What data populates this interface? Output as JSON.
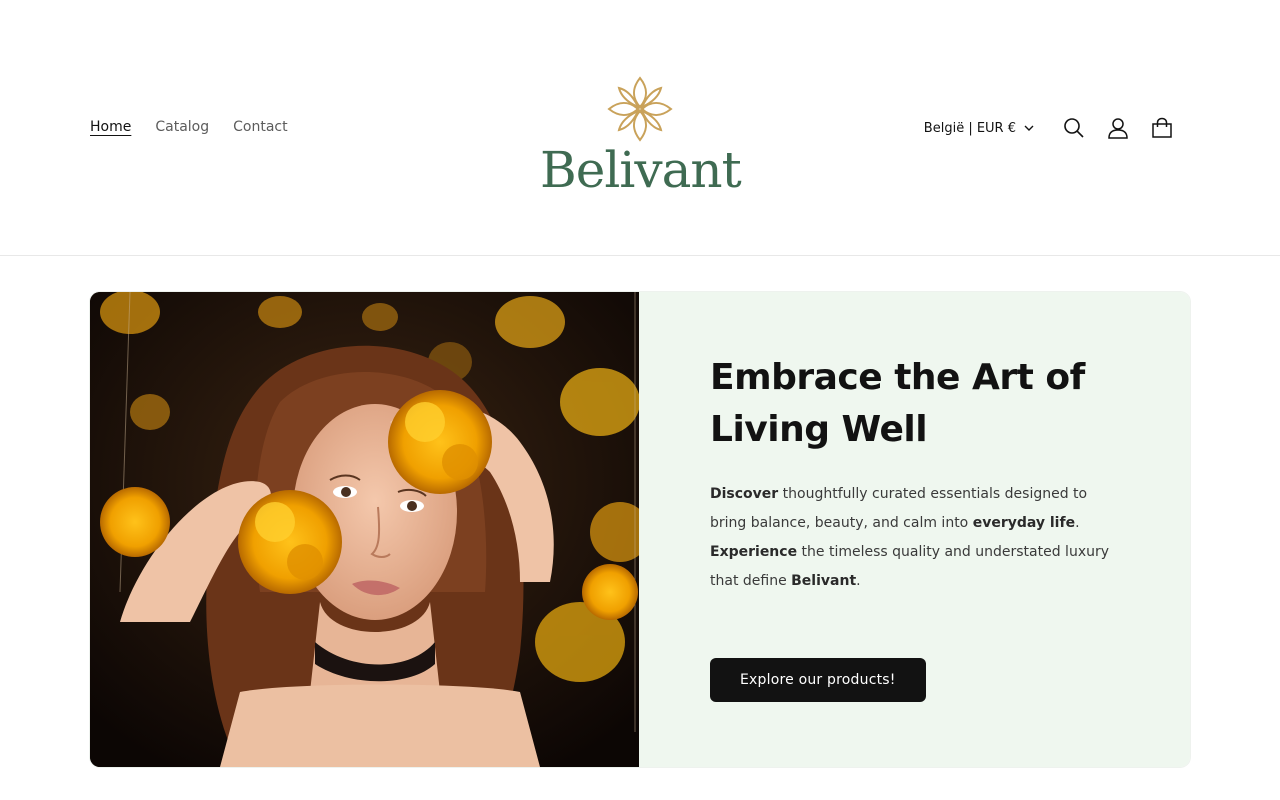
{
  "nav": {
    "items": [
      {
        "label": "Home",
        "active": true
      },
      {
        "label": "Catalog",
        "active": false
      },
      {
        "label": "Contact",
        "active": false
      }
    ]
  },
  "logo": {
    "wordmark": "Belivant",
    "color": "#3f6b52",
    "emblem_color": "#c9a25a"
  },
  "header_right": {
    "locale_label": "België | EUR €",
    "icons": [
      "search-icon",
      "account-icon",
      "cart-icon"
    ]
  },
  "hero": {
    "title": "Embrace the Art of Living Well",
    "description": {
      "p1_bold": "Discover",
      "p1_text": " thoughtfully curated essentials designed to bring balance, beauty, and calm into ",
      "p1_bold2": "everyday life",
      "p1_end": ".",
      "p2_bold": "Experience",
      "p2_text": " the timeless quality and understated luxury that define ",
      "p2_bold2": "Belivant",
      "p2_end": "."
    },
    "cta_label": "Explore our products!",
    "background": "#eff7ef"
  }
}
